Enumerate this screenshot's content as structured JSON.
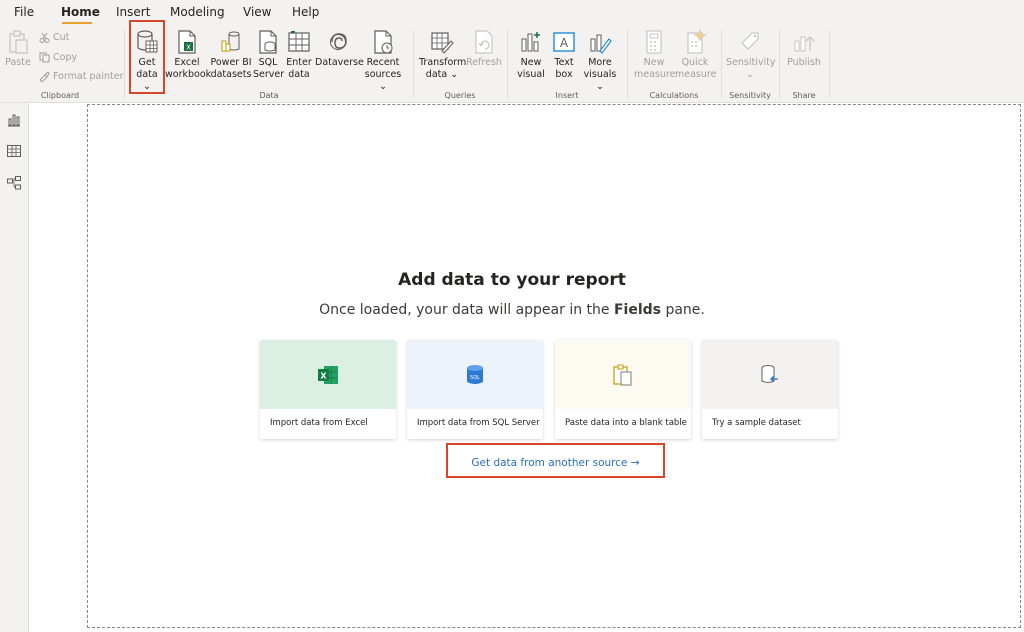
{
  "menu": {
    "items": [
      "File",
      "Home",
      "Insert",
      "Modeling",
      "View",
      "Help"
    ]
  },
  "ribbon": {
    "clipboard": {
      "paste": "Paste",
      "cut": "Cut",
      "copy": "Copy",
      "format_painter": "Format painter",
      "group": "Clipboard"
    },
    "data": {
      "get_data": [
        "Get",
        "data ⌄"
      ],
      "excel": [
        "Excel",
        "workbook"
      ],
      "powerbi": [
        "Power BI",
        "datasets"
      ],
      "sql": [
        "SQL",
        "Server"
      ],
      "enter": [
        "Enter",
        "data"
      ],
      "dataverse": [
        "Dataverse"
      ],
      "recent": [
        "Recent",
        "sources ⌄"
      ],
      "group": "Data"
    },
    "queries": {
      "transform": [
        "Transform",
        "data ⌄"
      ],
      "refresh": [
        "Refresh"
      ],
      "group": "Queries"
    },
    "insert": {
      "new_visual": [
        "New",
        "visual"
      ],
      "text_box": [
        "Text",
        "box"
      ],
      "more_visuals": [
        "More",
        "visuals ⌄"
      ],
      "group": "Insert"
    },
    "calculations": {
      "new_measure": [
        "New",
        "measure"
      ],
      "quick_measure": [
        "Quick",
        "measure"
      ],
      "group": "Calculations"
    },
    "sensitivity": {
      "button": [
        "Sensitivity",
        "⌄"
      ],
      "group": "Sensitivity"
    },
    "share": {
      "publish": [
        "Publish"
      ],
      "group": "Share"
    }
  },
  "canvas": {
    "title": "Add data to your report",
    "subtitle_pre": "Once loaded, your data will appear in the ",
    "subtitle_bold": "Fields",
    "subtitle_post": " pane.",
    "cards": [
      {
        "label": "Import data from Excel",
        "bg": "#dcefe3"
      },
      {
        "label": "Import data from SQL Server",
        "bg": "#edf3fb"
      },
      {
        "label": "Paste data into a blank table",
        "bg": "#fdfaf2"
      },
      {
        "label": "Try a sample dataset",
        "bg": "#f3f2f1"
      }
    ],
    "link": "Get data from another source →"
  },
  "colors": {
    "highlight": "#d9452b",
    "accent": "#e6a02f",
    "link": "#2a6fb5"
  }
}
